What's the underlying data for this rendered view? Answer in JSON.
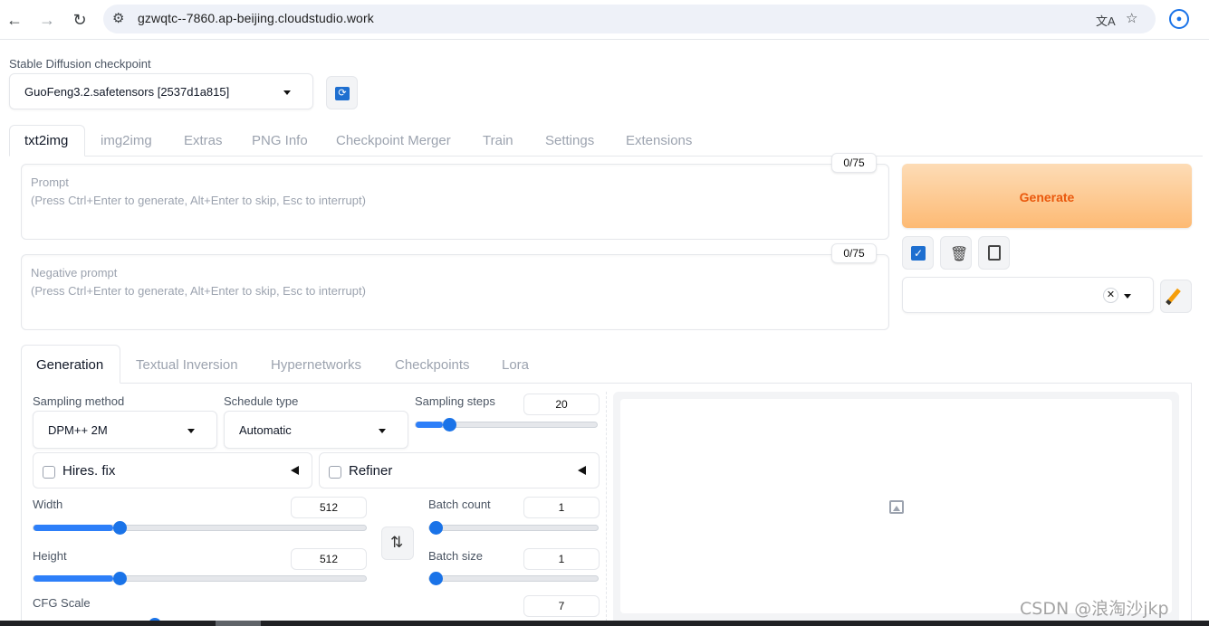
{
  "browser": {
    "url": "gzwqtc--7860.ap-beijing.cloudstudio.work"
  },
  "checkpoint": {
    "label": "Stable Diffusion checkpoint",
    "value": "GuoFeng3.2.safetensors [2537d1a815]"
  },
  "main_tabs": [
    "txt2img",
    "img2img",
    "Extras",
    "PNG Info",
    "Checkpoint Merger",
    "Train",
    "Settings",
    "Extensions"
  ],
  "prompt": {
    "title": "Prompt",
    "hint": "(Press Ctrl+Enter to generate, Alt+Enter to skip, Esc to interrupt)",
    "counter": "0/75"
  },
  "negative_prompt": {
    "title": "Negative prompt",
    "hint": "(Press Ctrl+Enter to generate, Alt+Enter to skip, Esc to interrupt)",
    "counter": "0/75"
  },
  "generate_label": "Generate",
  "sub_tabs": [
    "Generation",
    "Textual Inversion",
    "Hypernetworks",
    "Checkpoints",
    "Lora"
  ],
  "sampling_method": {
    "label": "Sampling method",
    "value": "DPM++ 2M"
  },
  "schedule_type": {
    "label": "Schedule type",
    "value": "Automatic"
  },
  "sampling_steps": {
    "label": "Sampling steps",
    "value": "20",
    "fraction": 0.15
  },
  "hires_fix": {
    "label": "Hires. fix"
  },
  "refiner": {
    "label": "Refiner"
  },
  "width": {
    "label": "Width",
    "value": "512",
    "fraction": 0.24
  },
  "height": {
    "label": "Height",
    "value": "512",
    "fraction": 0.24
  },
  "batch_count": {
    "label": "Batch count",
    "value": "1",
    "fraction": 0.0
  },
  "batch_size": {
    "label": "Batch size",
    "value": "1",
    "fraction": 0.0
  },
  "cfg_scale": {
    "label": "CFG Scale",
    "value": "7"
  },
  "watermark": "CSDN @浪淘沙jkp",
  "colors": {
    "accent": "#1a73e8",
    "generate_text": "#ea580c"
  },
  "icons": [
    "back-icon",
    "forward-icon",
    "reload-icon",
    "site-info-icon",
    "translate-icon",
    "star-icon",
    "profile-icon",
    "refresh-icon",
    "checkbox-icon",
    "trash-icon",
    "clipboard-icon",
    "clear-icon",
    "paint-brush-icon",
    "swap-icon",
    "image-icon"
  ]
}
